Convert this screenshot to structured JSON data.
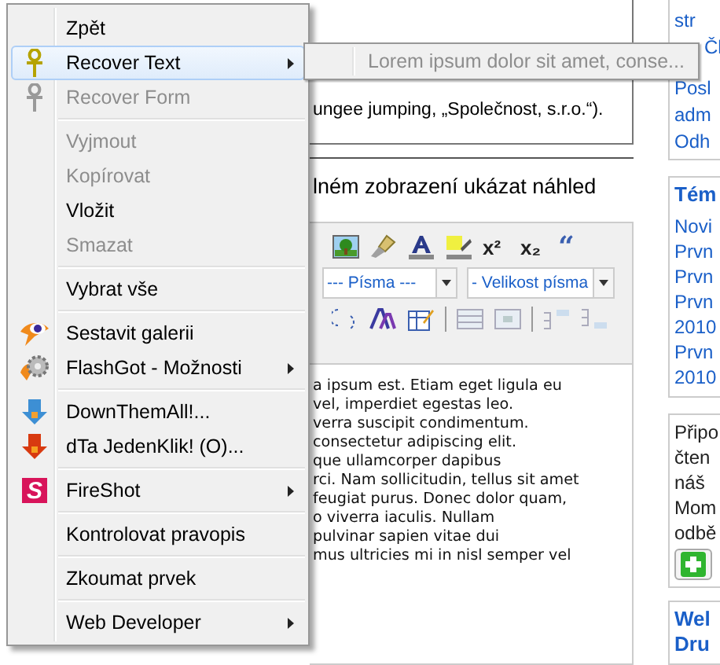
{
  "context_menu": {
    "items": [
      {
        "kind": "item",
        "label": "Zpět",
        "disabled": false,
        "selected": false,
        "submenu": false
      },
      {
        "kind": "item",
        "label": "Recover Text",
        "disabled": false,
        "selected": true,
        "submenu": true
      },
      {
        "kind": "item",
        "label": "Recover Form",
        "disabled": true,
        "selected": false,
        "submenu": false
      },
      {
        "kind": "separator"
      },
      {
        "kind": "item",
        "label": "Vyjmout",
        "disabled": true,
        "selected": false,
        "submenu": false
      },
      {
        "kind": "item",
        "label": "Kopírovat",
        "disabled": true,
        "selected": false,
        "submenu": false
      },
      {
        "kind": "item",
        "label": "Vložit",
        "disabled": false,
        "selected": false,
        "submenu": false
      },
      {
        "kind": "item",
        "label": "Smazat",
        "disabled": true,
        "selected": false,
        "submenu": false
      },
      {
        "kind": "separator"
      },
      {
        "kind": "item",
        "label": "Vybrat vše",
        "disabled": false,
        "selected": false,
        "submenu": false
      },
      {
        "kind": "separator"
      },
      {
        "kind": "item",
        "label": "Sestavit galerii",
        "disabled": false,
        "selected": false,
        "submenu": false
      },
      {
        "kind": "item",
        "label": "FlashGot - Možnosti",
        "disabled": false,
        "selected": false,
        "submenu": true
      },
      {
        "kind": "separator"
      },
      {
        "kind": "item",
        "label": "DownThemAll!...",
        "disabled": false,
        "selected": false,
        "submenu": false
      },
      {
        "kind": "item",
        "label": "dTa JedenKlik! (O)...",
        "disabled": false,
        "selected": false,
        "submenu": false
      },
      {
        "kind": "separator"
      },
      {
        "kind": "item",
        "label": "FireShot",
        "disabled": false,
        "selected": false,
        "submenu": true,
        "icon_text": "S"
      },
      {
        "kind": "separator"
      },
      {
        "kind": "item",
        "label": "Kontrolovat pravopis",
        "disabled": false,
        "selected": false,
        "submenu": false
      },
      {
        "kind": "separator"
      },
      {
        "kind": "item",
        "label": "Zkoumat prvek",
        "disabled": false,
        "selected": false,
        "submenu": false
      },
      {
        "kind": "separator"
      },
      {
        "kind": "item",
        "label": "Web Developer",
        "disabled": false,
        "selected": false,
        "submenu": true
      }
    ]
  },
  "submenu": {
    "items": [
      {
        "label": "Lorem ipsum dolor sit amet, conse...",
        "disabled": true
      }
    ]
  },
  "page": {
    "notice": "ungee jumping, „Společnost, s.r.o.“).",
    "preview_option": "lném zobrazení ukázat náhled",
    "editor": {
      "toolbar_glyphs": [
        "x²",
        "x₂",
        "“"
      ],
      "font_select": "--- Písma ---",
      "size_select": "- Velikost písma",
      "text_lines": [
        "a ipsum est. Etiam eget ligula eu",
        "vel, imperdiet egestas leo.",
        "verra suscipit condimentum.",
        "consectetur adipiscing elit.",
        "que ullamcorper dapibus",
        "rci. Nam sollicitudin, tellus sit amet",
        "feugiat purus. Donec dolor quam,",
        "o viverra iaculis. Nullam",
        "pulvinar sapien vitae dui",
        "mus ultricies mi in nisl semper vel"
      ]
    },
    "sidebar": {
      "links": [
        {
          "kind": "line",
          "text": "str"
        },
        {
          "kind": "indented",
          "text": "Čl"
        },
        {
          "kind": "line",
          "text": "Posl"
        },
        {
          "kind": "line",
          "text": "adm"
        },
        {
          "kind": "line",
          "text": "Odh"
        }
      ],
      "topics": {
        "heading": "Tém",
        "links": [
          [
            "Novi"
          ],
          [
            "Prvn"
          ],
          [
            "Prvn"
          ],
          [
            "Prvn",
            "2010"
          ],
          [
            "Prvn",
            "2010"
          ]
        ]
      },
      "subscribe": {
        "lines": [
          "Připo",
          "čten",
          "náš",
          "Mom",
          "odbě"
        ]
      },
      "next_heading": [
        "Wel",
        "Dru"
      ]
    }
  }
}
